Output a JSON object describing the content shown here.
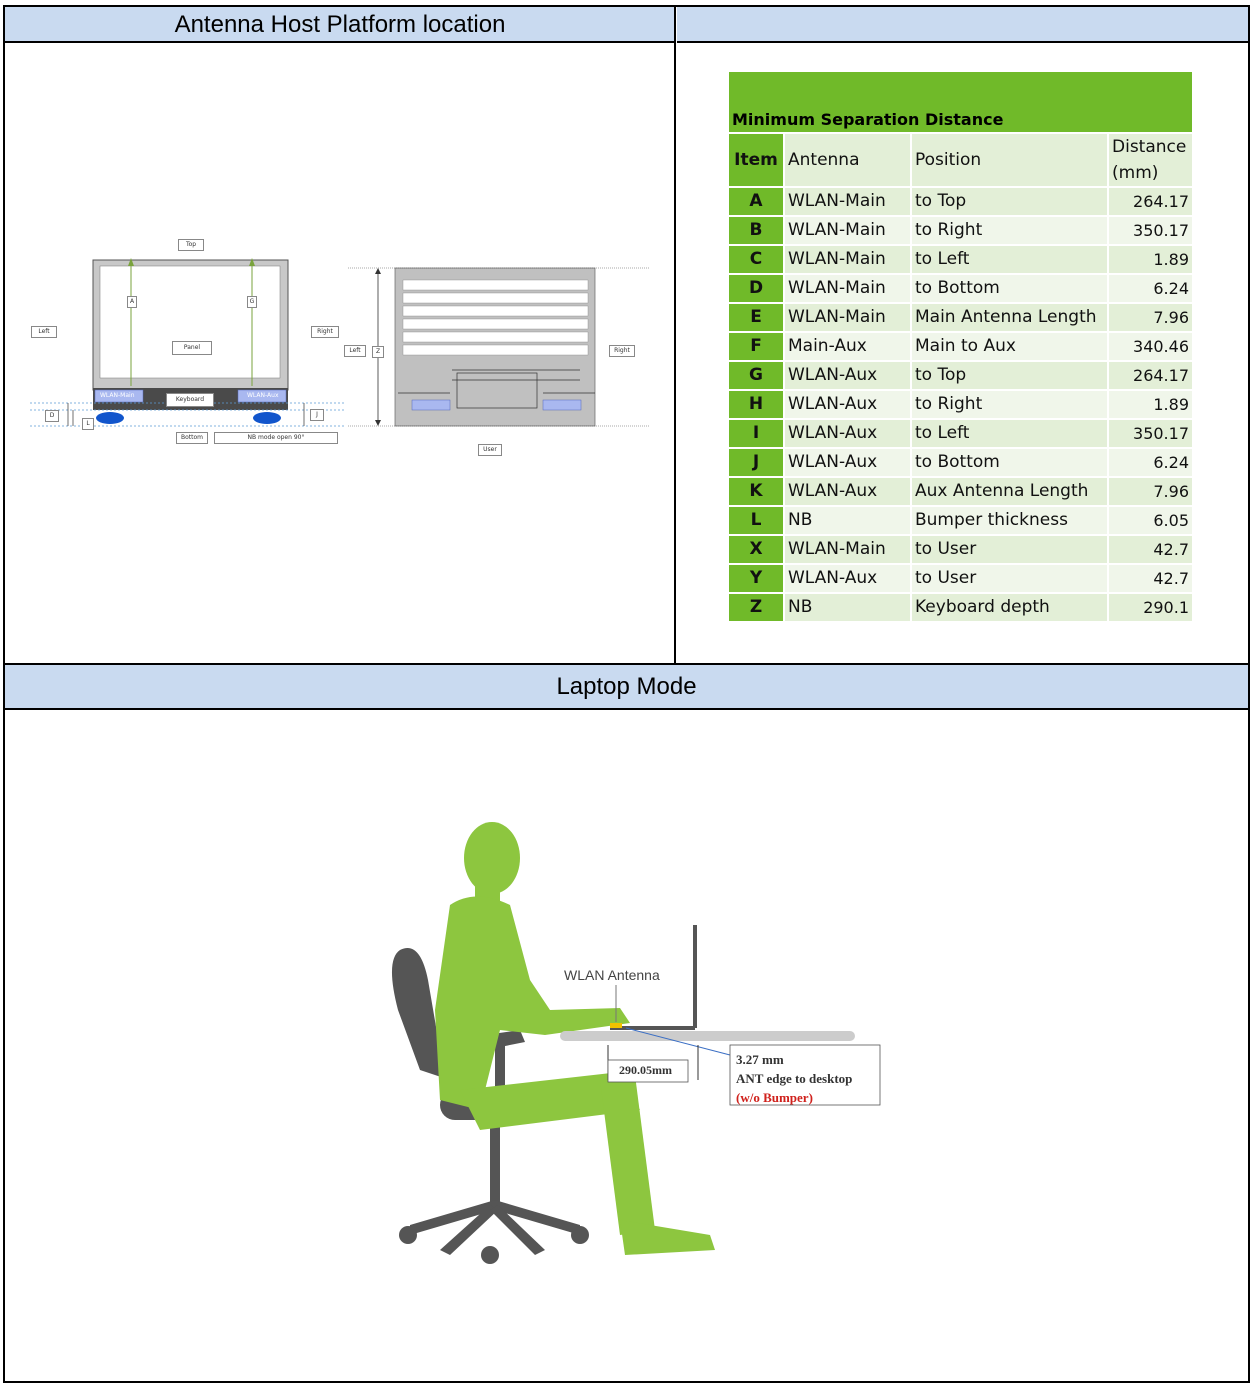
{
  "header_left": "Antenna Host Platform location",
  "header_right": "",
  "header_bottom": "Laptop Mode",
  "diagram": {
    "top": "Top",
    "left": "Left",
    "right": "Right",
    "bottom": "Bottom",
    "panel": "Panel",
    "keyboard": "Keyboard",
    "wlan_main": "WLAN-Main",
    "wlan_aux": "WLAN-Aux",
    "nb_mode": "NB mode open 90°",
    "user": "User",
    "a": "A",
    "g": "G",
    "d": "D",
    "l": "L",
    "j": "J",
    "z": "Z",
    "c": "C",
    "e": "E",
    "i": "I",
    "x": "X",
    "f": "F",
    "b": "B",
    "k": "K",
    "h": "H",
    "y": "Y"
  },
  "table": {
    "title": "Minimum Separation Distance",
    "headers": [
      "Item",
      "Antenna",
      "Position",
      "Distance (mm)"
    ],
    "rows": [
      [
        "A",
        "WLAN-Main",
        "to Top",
        "264.17"
      ],
      [
        "B",
        "WLAN-Main",
        "to Right",
        "350.17"
      ],
      [
        "C",
        "WLAN-Main",
        "to Left",
        "1.89"
      ],
      [
        "D",
        "WLAN-Main",
        "to Bottom",
        "6.24"
      ],
      [
        "E",
        "WLAN-Main",
        "Main Antenna Length",
        "7.96"
      ],
      [
        "F",
        "Main-Aux",
        "Main to Aux",
        "340.46"
      ],
      [
        "G",
        "WLAN-Aux",
        "to Top",
        "264.17"
      ],
      [
        "H",
        "WLAN-Aux",
        "to Right",
        "1.89"
      ],
      [
        "I",
        "WLAN-Aux",
        "to Left",
        "350.17"
      ],
      [
        "J",
        "WLAN-Aux",
        "to Bottom",
        "6.24"
      ],
      [
        "K",
        "WLAN-Aux",
        "Aux Antenna Length",
        "7.96"
      ],
      [
        "L",
        "NB",
        "Bumper thickness",
        "6.05"
      ],
      [
        "X",
        "WLAN-Main",
        "to User",
        "42.7"
      ],
      [
        "Y",
        "WLAN-Aux",
        "to User",
        "42.7"
      ],
      [
        "Z",
        "NB",
        "Keyboard depth",
        "290.1"
      ]
    ]
  },
  "laptop_mode": {
    "wlan_antenna": "WLAN Antenna",
    "keyboard_depth": "290.05mm",
    "distance": "3.27 mm",
    "edge_note": "ANT edge to desktop",
    "bumper_note": "(w/o Bumper)",
    "colors": {
      "figure": "#8dc63f",
      "chair": "#555555",
      "desk": "#cccccc",
      "note_red": "#d0211c"
    }
  }
}
